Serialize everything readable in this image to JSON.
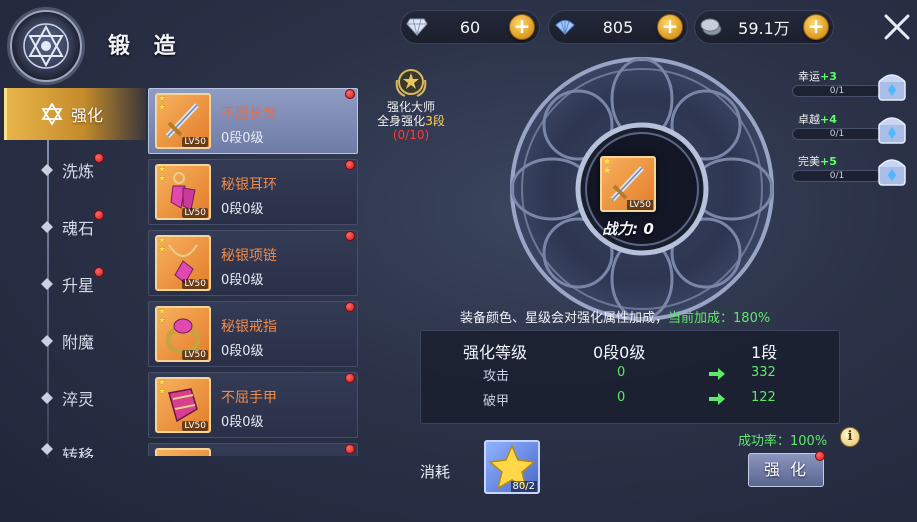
{
  "header": {
    "title": "锻 造"
  },
  "currencies": [
    {
      "icon": "diamond-icon",
      "value": "60"
    },
    {
      "icon": "shell-icon",
      "value": "805"
    },
    {
      "icon": "silver-coin-icon",
      "value": "59.1万"
    }
  ],
  "sidebar": {
    "items": [
      {
        "label": "强化",
        "active": true,
        "badge": false
      },
      {
        "label": "洗炼",
        "active": false,
        "badge": true
      },
      {
        "label": "魂石",
        "active": false,
        "badge": true
      },
      {
        "label": "升星",
        "active": false,
        "badge": true
      },
      {
        "label": "附魔",
        "active": false,
        "badge": false
      },
      {
        "label": "淬灵",
        "active": false,
        "badge": false
      },
      {
        "label": "转移",
        "active": false,
        "badge": true
      }
    ]
  },
  "equipment": [
    {
      "name": "不屈长剑",
      "level": "0段0级",
      "lv": "LV50",
      "icon": "sword-icon",
      "selected": true
    },
    {
      "name": "秘银耳环",
      "level": "0段0级",
      "lv": "LV50",
      "icon": "earring-icon",
      "selected": false
    },
    {
      "name": "秘银项链",
      "level": "0段0级",
      "lv": "LV50",
      "icon": "necklace-icon",
      "selected": false
    },
    {
      "name": "秘银戒指",
      "level": "0段0级",
      "lv": "LV50",
      "icon": "ring-icon",
      "selected": false
    },
    {
      "name": "不屈手甲",
      "level": "0段0级",
      "lv": "LV50",
      "icon": "gauntlet-icon",
      "selected": false
    }
  ],
  "master": {
    "title": "强化大师",
    "line2_prefix": "全身强化",
    "line2_value": "3段",
    "progress": "(0/10)"
  },
  "core": {
    "lv": "LV50",
    "power_label": "战力: 0"
  },
  "bonuses": [
    {
      "label": "幸运",
      "plus": "+3",
      "progress": "0/1"
    },
    {
      "label": "卓越",
      "plus": "+4",
      "progress": "0/1"
    },
    {
      "label": "完美",
      "plus": "+5",
      "progress": "0/1"
    }
  ],
  "hint": {
    "text": "装备颜色、星级会对强化属性加成，",
    "current_label": "当前加成：",
    "current_value": "180%"
  },
  "stats": {
    "header_name": "强化等级",
    "header_current": "0段0级",
    "header_next": "1段",
    "rows": [
      {
        "name": "攻击",
        "current": "0",
        "next": "332"
      },
      {
        "name": "破甲",
        "current": "0",
        "next": "122"
      }
    ]
  },
  "success_rate": "成功率：100%",
  "cost": {
    "label": "消耗",
    "count": "80/2"
  },
  "enhance_button": "强化",
  "colors": {
    "accent_gold": "#e8b54a",
    "green": "#5fe86a",
    "orange_name": "#f08a4a",
    "red_badge": "#d31919"
  }
}
